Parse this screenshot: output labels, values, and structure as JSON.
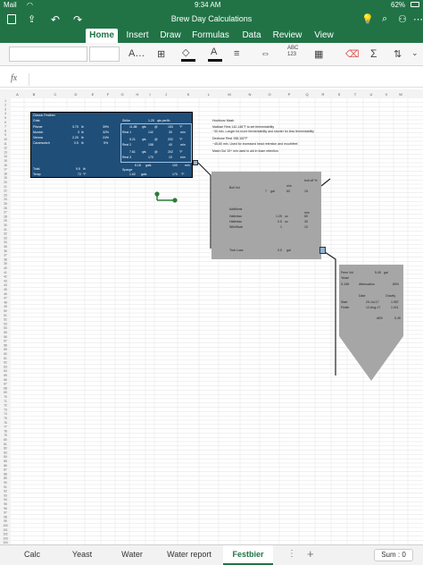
{
  "status": {
    "carrier": "Mail",
    "time": "9:34 AM",
    "battery": "62%"
  },
  "app": {
    "title": "Brew Day Calculations"
  },
  "ribbon_tabs": [
    {
      "label": "Home",
      "active": true
    },
    {
      "label": "Insert"
    },
    {
      "label": "Draw"
    },
    {
      "label": "Formulas"
    },
    {
      "label": "Data"
    },
    {
      "label": "Review"
    },
    {
      "label": "View"
    }
  ],
  "formula": {
    "label": "fx",
    "value": ""
  },
  "columns": [
    "A",
    "B",
    "C",
    "D",
    "E",
    "F",
    "G",
    "H",
    "I",
    "J",
    "K",
    "L",
    "M",
    "N",
    "O",
    "P",
    "Q",
    "R",
    "S",
    "T",
    "U",
    "V",
    "W"
  ],
  "rows": [
    "1",
    "2",
    "3",
    "4",
    "5",
    "6",
    "7",
    "8",
    "9",
    "10",
    "11",
    "12",
    "13",
    "14",
    "15",
    "16",
    "17",
    "18",
    "19",
    "20",
    "21",
    "22",
    "23",
    "24",
    "25",
    "26",
    "27",
    "28",
    "29",
    "30",
    "31",
    "32",
    "33",
    "34",
    "35",
    "36",
    "37",
    "38",
    "39",
    "40",
    "41",
    "42",
    "43",
    "44",
    "45",
    "46",
    "47",
    "48",
    "49",
    "50",
    "51",
    "52",
    "53",
    "54",
    "55",
    "56",
    "57",
    "58",
    "59",
    "60",
    "61",
    "62",
    "63",
    "64",
    "65",
    "66",
    "67",
    "68",
    "69",
    "70",
    "71",
    "72",
    "73",
    "74",
    "75",
    "76",
    "77",
    "78",
    "79",
    "80",
    "81",
    "82",
    "83",
    "84",
    "85",
    "86",
    "87",
    "88",
    "89",
    "90",
    "91",
    "92",
    "93",
    "94",
    "95",
    "96",
    "97",
    "98",
    "99",
    "100",
    "101",
    "102",
    "103",
    "104",
    "105"
  ],
  "recipe": {
    "title": "Classic Festbier",
    "grist_label": "Grist:",
    "grains": [
      {
        "name": "Pilsner",
        "amount": "3.75",
        "unit": "lb",
        "pct": "39%"
      },
      {
        "name": "Munich",
        "amount": "3",
        "unit": "lb",
        "pct": "32%"
      },
      {
        "name": "Vienna",
        "amount": "2.25",
        "unit": "lb",
        "pct": "24%"
      },
      {
        "name": "Caramunich",
        "amount": "0.5",
        "unit": "lb",
        "pct": "5%"
      }
    ],
    "total": {
      "label": "Total",
      "amount": "9.5",
      "unit": "lb"
    },
    "temp": {
      "label": "Temp",
      "value": "72",
      "unit": "°F"
    },
    "strike": {
      "label": "Strike",
      "ratio": "1.25",
      "ratio_unit": "qts per/lb"
    },
    "strike_vol": {
      "value": "11.88",
      "unit": "qts",
      "at": "@",
      "temp": "153",
      "temp_unit": "°F"
    },
    "rest1": {
      "label": "Rest 1",
      "temp": "142",
      "time": "30",
      "unit": "min"
    },
    "rest2_pre": {
      "value": "5.21",
      "unit": "qts",
      "at": "@",
      "temp": "202",
      "temp_unit": "°F"
    },
    "rest2": {
      "label": "Rest 2",
      "temp": "158",
      "time": "40",
      "unit": "min"
    },
    "rest3_pre": {
      "value": "7.61",
      "unit": "qts",
      "at": "@",
      "temp": "202",
      "temp_unit": "°F"
    },
    "rest3": {
      "label": "Rest 3",
      "temp": "170",
      "time": "10",
      "unit": "min"
    },
    "mash_vol": {
      "value": "6.18",
      "unit": "gals",
      "temp": "100",
      "temp_unit": "min"
    },
    "sparge": {
      "label": "Sparge",
      "value": "1.62",
      "unit": "gals",
      "temp": "170",
      "temp_unit": "°F"
    }
  },
  "notes": {
    "title": "Hochkurz Mash",
    "lines": [
      "Maltose Rest 142-146°F to set fermentability",
      "~30 min. Longer for more fermentability and shorter for less fermentability",
      "Dextrose Rest 158-162°F",
      "~45-60 min. Used for increased head retention and mouthfeel",
      "Mash Out 10+ min used to aid in foam retention"
    ]
  },
  "kettle": {
    "boil_vol_label": "Boil Vol",
    "boil_vol": "7",
    "boil_unit": "gal",
    "min_label": "min",
    "boil_time": "60",
    "ibu_header": "boil off %",
    "ibu": "15",
    "additions_label": "Additions",
    "additions_min": "min",
    "hops": [
      {
        "name": "Hallertau",
        "amount": "1.25",
        "unit": "oz",
        "time": "60"
      },
      {
        "name": "Hallertau",
        "amount": "0.5",
        "unit": "oz",
        "time": "30"
      },
      {
        "name": "Whirlflock",
        "amount": "1",
        "unit": "",
        "time": "10"
      }
    ],
    "trub_label": "Trub Loss",
    "trub": "0.5",
    "trub_unit": "gal"
  },
  "fermenter": {
    "ferm_vol_label": "Ferm Vol",
    "ferm_vol": "5.45",
    "ferm_unit": "gal",
    "yeast_label": "Yeast",
    "yeast": "S-189",
    "atten_label": "Attenuation",
    "atten": "80%",
    "date_label": "Date",
    "gravity_label": "Gravity",
    "start_label": "Start",
    "start_date": "29-Jul-17",
    "start_grav": "1.057",
    "finish_label": "Finish",
    "finish_date": "12-Aug-17",
    "finish_grav": "1.011",
    "abv_label": "ABV",
    "abv": "5.45"
  },
  "sheet_tabs": [
    {
      "label": "Calc"
    },
    {
      "label": "Yeast"
    },
    {
      "label": "Water"
    },
    {
      "label": "Water report"
    },
    {
      "label": "Festbier",
      "active": true
    }
  ],
  "sum": {
    "label": "Sum : 0"
  },
  "colors": {
    "excel_green": "#217346",
    "recipe_blue": "#1f4e79",
    "vessel_gray": "#a6a6a6"
  }
}
